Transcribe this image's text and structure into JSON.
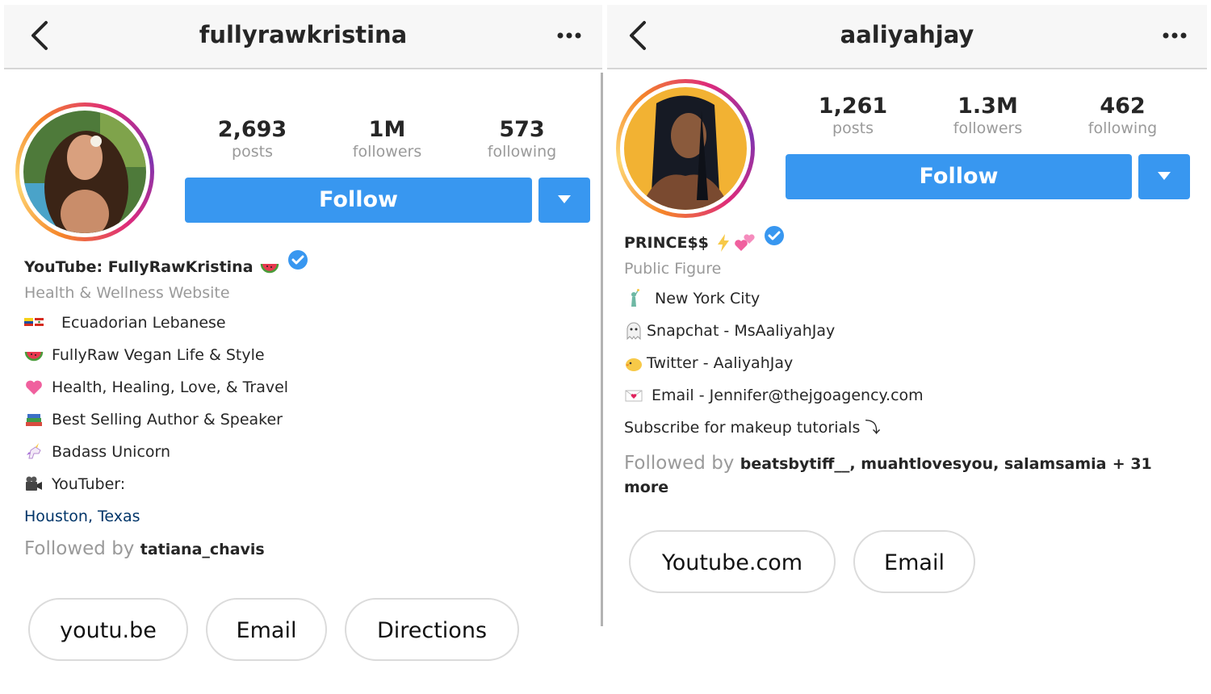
{
  "left": {
    "username": "fullyrawkristina",
    "stats": [
      {
        "value": "2,693",
        "label": "posts"
      },
      {
        "value": "1M",
        "label": "followers"
      },
      {
        "value": "573",
        "label": "following"
      }
    ],
    "follow_label": "Follow",
    "bio": {
      "name": "YouTube: FullyRawKristina",
      "category": "Health & Wellness Website",
      "lines": [
        {
          "icon": "flags-icon",
          "text": "Ecuadorian Lebanese"
        },
        {
          "icon": "watermelon-icon",
          "text": "FullyRaw Vegan Life & Style"
        },
        {
          "icon": "heart-icon",
          "text": "Health, Healing, Love, & Travel"
        },
        {
          "icon": "books-icon",
          "text": "Best Selling Author & Speaker"
        },
        {
          "icon": "unicorn-icon",
          "text": "Badass Unicorn"
        },
        {
          "icon": "camera-icon",
          "text": "YouTuber:"
        }
      ],
      "location": "Houston, Texas",
      "followed_prefix": "Followed by",
      "followed_users": "tatiana_chavis"
    },
    "buttons": [
      "youtu.be",
      "Email",
      "Directions"
    ]
  },
  "right": {
    "username": "aaliyahjay",
    "stats": [
      {
        "value": "1,261",
        "label": "posts"
      },
      {
        "value": "1.3M",
        "label": "followers"
      },
      {
        "value": "462",
        "label": "following"
      }
    ],
    "follow_label": "Follow",
    "bio": {
      "name": "PRINCE$$",
      "category": "Public Figure",
      "lines": [
        {
          "icon": "statue-of-liberty-icon",
          "text": "New York City"
        },
        {
          "icon": "ghost-icon",
          "text": "Snapchat - MsAaliyahJay"
        },
        {
          "icon": "chick-icon",
          "text": "Twitter - AaliyahJay"
        },
        {
          "icon": "love-letter-icon",
          "text": "Email - Jennifer@thejgoagency.com"
        },
        {
          "icon": "",
          "text": "Subscribe for makeup tutorials ⤵"
        }
      ],
      "followed_prefix": "Followed by",
      "followed_users": "beatsbytiff__, muahtlovesyou, salamsamia",
      "followed_suffix": "+ 31 more"
    },
    "buttons": [
      "Youtube.com",
      "Email"
    ]
  },
  "colors": {
    "accent": "#3897f0",
    "link": "#003569",
    "muted": "#9a9a9a"
  }
}
